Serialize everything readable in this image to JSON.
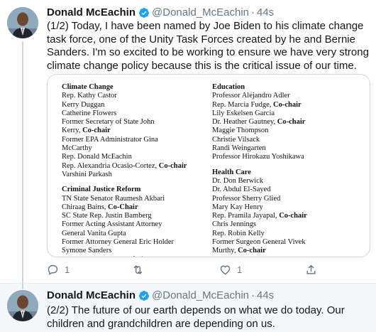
{
  "tweet1": {
    "author_name": "Donald McEachin",
    "handle": "@Donald_McEachin",
    "separator": "·",
    "time": "44s",
    "text": "(1/2) Today, I have been named by Joe Biden to his climate change task force, one of the Unity Task Forces created by he and Bernie Sanders. I'm so excited to be working to ensure we have very strong climate change policy because this is the critical issue of our time.",
    "image": {
      "left_column": [
        {
          "title": "Climate Change",
          "members": [
            {
              "name": "Rep. Kathy Castor",
              "role": ""
            },
            {
              "name": "Kerry Duggan",
              "role": ""
            },
            {
              "name": "Catherine Flowers",
              "role": ""
            },
            {
              "name": "Former Secretary of State John",
              "role": ""
            },
            {
              "name": "Kerry,",
              "role": "Co-chair"
            },
            {
              "name": "Former EPA Administrator Gina",
              "role": ""
            },
            {
              "name": "McCarthy",
              "role": ""
            },
            {
              "name": "Rep. Donald McEachin",
              "role": ""
            },
            {
              "name": "Rep. Alexandria Ocasio-Cortez,",
              "role": "Co-chair"
            },
            {
              "name": "Varshini Parkash",
              "role": ""
            }
          ]
        },
        {
          "title": "Criminal Justice Reform",
          "members": [
            {
              "name": "TN State Senator Raumesh Akbari",
              "role": ""
            },
            {
              "name": "Chiraag Bains,",
              "role": "Co-Chair"
            },
            {
              "name": "SC State Rep. Justin Bamberg",
              "role": ""
            },
            {
              "name": "Former Acting Assistant Attorney",
              "role": ""
            },
            {
              "name": "General Vanita Gupta",
              "role": ""
            },
            {
              "name": "Former Attorney General Eric Holder",
              "role": ""
            },
            {
              "name": "Symone Sanders",
              "role": ""
            },
            {
              "name": "Rep. Bobby Scott,",
              "role": "Co-chair"
            }
          ]
        }
      ],
      "right_column": [
        {
          "title": "Education",
          "members": [
            {
              "name": "Professor Alejandro Adler",
              "role": ""
            },
            {
              "name": "Rep. Marcia Fudge,",
              "role": "Co-chair"
            },
            {
              "name": "Lily Eskelsen Garcia",
              "role": ""
            },
            {
              "name": "Dr. Heather Gautney,",
              "role": "Co-chair"
            },
            {
              "name": "Maggie Thompson",
              "role": ""
            },
            {
              "name": "Christie Vilsack",
              "role": ""
            },
            {
              "name": "Randi Weingarten",
              "role": ""
            },
            {
              "name": "Professor Hirokazu Yoshikawa",
              "role": ""
            }
          ]
        },
        {
          "title": "Health Care",
          "members": [
            {
              "name": "Dr. Don Berwick",
              "role": ""
            },
            {
              "name": "Dr. Abdul El-Sayed",
              "role": ""
            },
            {
              "name": "Professor Sherry Glied",
              "role": ""
            },
            {
              "name": "Mary Kay Henry",
              "role": ""
            },
            {
              "name": "Rep. Pramila Jayapal,",
              "role": "Co-chair"
            },
            {
              "name": "Chris Jennings",
              "role": ""
            },
            {
              "name": "Rep. Robin Kelly",
              "role": ""
            },
            {
              "name": "Former Surgeon General Vivek",
              "role": ""
            },
            {
              "name": "Murthy,",
              "role": "Co-chair"
            }
          ]
        }
      ]
    },
    "actions": {
      "reply_count": "1",
      "retweet_count": "",
      "like_count": "1"
    }
  },
  "tweet2": {
    "author_name": "Donald McEachin",
    "handle": "@Donald_McEachin",
    "separator": "·",
    "time": "44s",
    "text": "(2/2) The future of our earth depends on what we do today. Our children and grandchildren are depending on us."
  },
  "colors": {
    "verified_blue": "#1da1f2",
    "muted_text": "#657786",
    "thread_line": "#ccd6dd",
    "second_tweet_bg": "#f5f8fa"
  },
  "icons": [
    "verified-badge-icon",
    "reply-icon",
    "retweet-icon",
    "like-icon",
    "share-icon"
  ]
}
